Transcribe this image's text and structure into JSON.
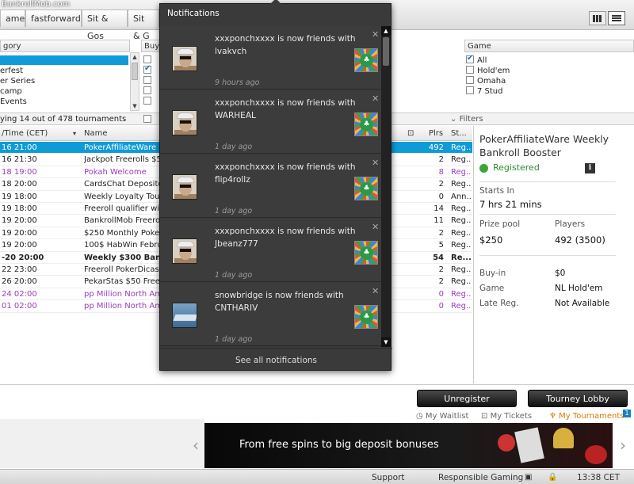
{
  "watermark": "BankrollMob.com",
  "tabs": [
    {
      "label": "ames"
    },
    {
      "label": "fastforward"
    },
    {
      "label": "Sit & Gos"
    },
    {
      "label": "Sit & G"
    }
  ],
  "filters": {
    "category": {
      "header": "gory",
      "items": [
        "",
        "erfest",
        "er Series",
        "camp",
        "Events"
      ]
    },
    "buyin": {
      "header": "Buy-"
    },
    "game": {
      "header": "Game",
      "items": [
        {
          "label": "All",
          "checked": true
        },
        {
          "label": "Hold'em",
          "checked": false
        },
        {
          "label": "Omaha",
          "checked": false
        },
        {
          "label": "7 Stud",
          "checked": false
        }
      ]
    },
    "showing": "ying 14 out of 478 tournaments",
    "filters_label": "Filters"
  },
  "table": {
    "headers": {
      "date": "/Time (CET)",
      "name": "Name",
      "plrs": "Plrs",
      "status": "St..."
    },
    "rows": [
      {
        "date": "16 21:00",
        "name": "PokerAffiliateWare",
        "plrs": "492",
        "status": "Reg...",
        "style": "sel"
      },
      {
        "date": "16 21:30",
        "name": "Jackpot Freerolls $5",
        "plrs": "2",
        "status": "Reg...",
        "style": ""
      },
      {
        "date": "18 19:00",
        "name": "Pokah Welcome",
        "plrs": "8",
        "status": "Reg...",
        "style": "purple"
      },
      {
        "date": "18 20:00",
        "name": "CardsChat Deposito",
        "plrs": "2",
        "status": "Reg...",
        "style": ""
      },
      {
        "date": "19 18:00",
        "name": "Weekly Loyalty Tour",
        "plrs": "0",
        "status": "Ann...",
        "style": ""
      },
      {
        "date": "19 18:00",
        "name": "Freeroll qualifier wit",
        "plrs": "14",
        "status": "Reg...",
        "style": ""
      },
      {
        "date": "19 20:00",
        "name": "BankrollMob Freerol",
        "plrs": "11",
        "status": "Reg...",
        "style": ""
      },
      {
        "date": "19 20:00",
        "name": "$250 Monthly Poker",
        "plrs": "2",
        "status": "Reg...",
        "style": ""
      },
      {
        "date": "19 20:00",
        "name": "100$ HabWin Febru",
        "plrs": "5",
        "status": "Reg...",
        "style": ""
      },
      {
        "date": "-20 20:00",
        "name": "Weekly $300 Bank",
        "plrs": "54",
        "status": "Re...",
        "style": "bold"
      },
      {
        "date": "22 23:00",
        "name": "Freeroll PokerDicas",
        "plrs": "2",
        "status": "Reg...",
        "style": ""
      },
      {
        "date": "26 20:00",
        "name": "PekarStas $50 Free",
        "plrs": "2",
        "status": "Reg...",
        "style": ""
      },
      {
        "date": "24 02:00",
        "name": "pp Million North Ame",
        "plrs": "0",
        "status": "Reg...",
        "style": "purple"
      },
      {
        "date": "01 02:00",
        "name": "pp Million North Ame",
        "plrs": "0",
        "status": "Reg...",
        "style": "purple"
      }
    ]
  },
  "detail": {
    "title": "PokerAffiliateWare Weekly Bankroll Booster",
    "status": "Registered",
    "starts_in_label": "Starts In",
    "starts_in": "7 hrs  21 mins",
    "prize_pool_label": "Prize pool",
    "prize_pool": "$250",
    "players_label": "Players",
    "players": "492 (3500)",
    "buyin_label": "Buy-in",
    "buyin": "$0",
    "game_label": "Game",
    "game": "NL Hold'em",
    "latereg_label": "Late Reg.",
    "latereg": "Not Available"
  },
  "actions": {
    "unregister": "Unregister",
    "tourney_lobby": "Tourney Lobby",
    "my_waitlist": "My Waitlist",
    "my_tickets": "My Tickets",
    "my_tournaments": "My Tournaments",
    "my_tournaments_count": "1"
  },
  "banner": {
    "text": "From free spins to big deposit bonuses"
  },
  "footer": {
    "support": "Support",
    "responsible_gaming": "Responsible Gaming",
    "time": "13:38 CET"
  },
  "notifications": {
    "title": "Notifications",
    "see_all": "See all notifications",
    "items": [
      {
        "text": "xxxponchxxxx is now friends with lvakvch",
        "time": "9 hours ago",
        "avatar": "ponch"
      },
      {
        "text": "xxxponchxxxx is now friends with WARHEAL",
        "time": "1 day ago",
        "avatar": "ponch"
      },
      {
        "text": "xxxponchxxxx is now friends with flip4rollz",
        "time": "1 day ago",
        "avatar": "ponch"
      },
      {
        "text": "xxxponchxxxx is now friends with Jbeanz777",
        "time": "1 day ago",
        "avatar": "ponch"
      },
      {
        "text": "snowbridge is now friends with CNTHARIV",
        "time": "1 day ago",
        "avatar": "ship"
      }
    ]
  }
}
